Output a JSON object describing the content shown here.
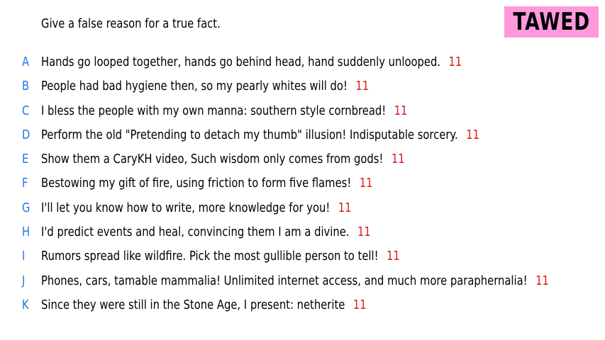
{
  "prompt": "Give a false reason for a true fact.",
  "badge": {
    "text": "TAWED",
    "color": "#ff99dd"
  },
  "colors": {
    "letter": "#1f78e0",
    "score": "#e01818",
    "text": "#000000"
  },
  "entries": [
    {
      "letter": "A",
      "text": "Hands go looped together, hands go behind head, hand suddenly unlooped.",
      "score": "11"
    },
    {
      "letter": "B",
      "text": "People had bad hygiene then, so my pearly whites will do!",
      "score": "11"
    },
    {
      "letter": "C",
      "text": "I bless the people with my own manna: southern style cornbread!",
      "score": "11"
    },
    {
      "letter": "D",
      "text": "Perform the old \"Pretending to detach my thumb\" illusion! Indisputable sorcery.",
      "score": "11"
    },
    {
      "letter": "E",
      "text": "Show them a CaryKH video, Such wisdom only comes from gods!",
      "score": "11"
    },
    {
      "letter": "F",
      "text": "Bestowing my gift of fire, using friction to form five flames!",
      "score": "11"
    },
    {
      "letter": "G",
      "text": "I'll let you know how to write, more knowledge for you!",
      "score": "11"
    },
    {
      "letter": "H",
      "text": "I'd predict events and heal, convincing them I am a divine.",
      "score": "11"
    },
    {
      "letter": "I",
      "text": "Rumors spread like wildfire. Pick the most gullible person to tell!",
      "score": "11"
    },
    {
      "letter": "J",
      "text": "Phones, cars, tamable mammalia! Unlimited internet access, and much more paraphernalia!",
      "score": "11"
    },
    {
      "letter": "K",
      "text": "Since they were still in the Stone Age, I present: netherite",
      "score": "11"
    }
  ]
}
